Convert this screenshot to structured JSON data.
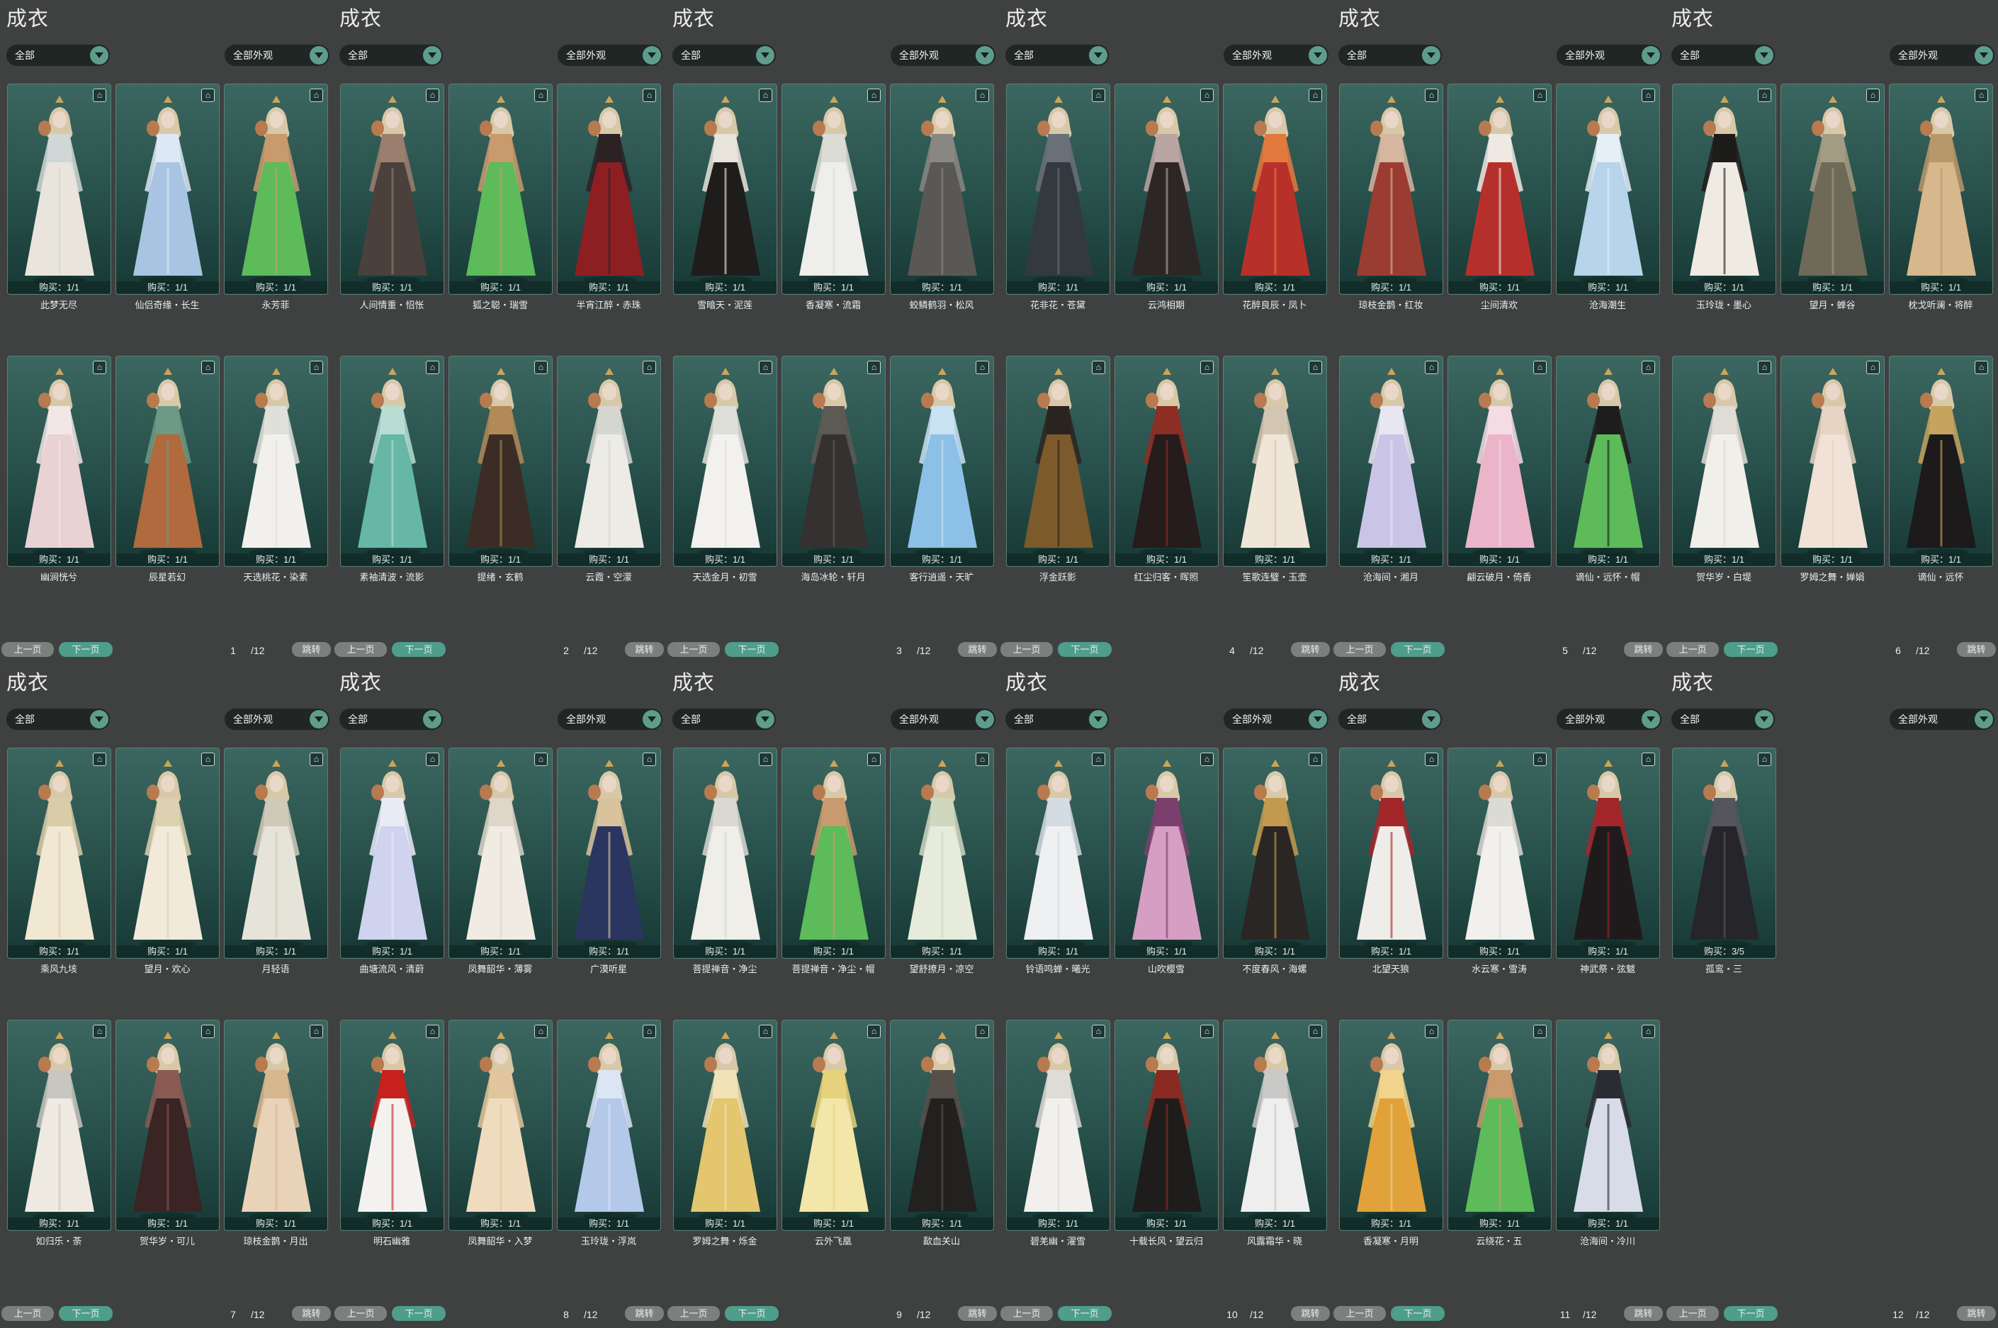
{
  "labels": {
    "category_title": "成衣",
    "filter_all": "全部",
    "filter_appearance": "全部外观",
    "prev_page": "上一页",
    "next_page": "下一页",
    "jump": "跳转",
    "lock_icon": "lock-icon"
  },
  "panels": [
    {
      "page": "1",
      "total": "/12",
      "items": [
        {
          "name": "此梦无尽",
          "buy": "购买：1/1",
          "colors": [
            "#e9e5dc",
            "#cfd8d6"
          ]
        },
        {
          "name": "仙侣奇缘・长生",
          "buy": "购买：1/1",
          "colors": [
            "#a9c4e3",
            "#dce8f3"
          ]
        },
        {
          "name": "永芳菲",
          "buy": "购买：1/1",
          "colors": [
            "#5dbb5a",
            "#c89a6e"
          ]
        },
        {
          "name": "幽涧恍兮",
          "buy": "购买：1/1",
          "colors": [
            "#e8d2d4",
            "#f1e6e6"
          ]
        },
        {
          "name": "辰星若幻",
          "buy": "购买：1/1",
          "colors": [
            "#b06a3d",
            "#6c9a84"
          ]
        },
        {
          "name": "天选桃花・染素",
          "buy": "购买：1/1",
          "colors": [
            "#f1f0ec",
            "#e0e0da"
          ]
        }
      ]
    },
    {
      "page": "2",
      "total": "/12",
      "items": [
        {
          "name": "人间情重・怊怅",
          "buy": "购买：1/1",
          "colors": [
            "#4a403c",
            "#9b7f6e"
          ]
        },
        {
          "name": "狐之聪・瑞雪",
          "buy": "购买：1/1",
          "colors": [
            "#5dbb5a",
            "#c89a6e"
          ]
        },
        {
          "name": "半宵江醉・赤珠",
          "buy": "购买：1/1",
          "colors": [
            "#8d1f22",
            "#2b2224"
          ]
        },
        {
          "name": "素袖清波・流影",
          "buy": "购买：1/1",
          "colors": [
            "#67b7a6",
            "#b8ddd3"
          ]
        },
        {
          "name": "提绪・玄鹤",
          "buy": "购买：1/1",
          "colors": [
            "#3b2d26",
            "#b28a57"
          ]
        },
        {
          "name": "云霞・空濛",
          "buy": "购买：1/1",
          "colors": [
            "#ecebe6",
            "#d6d6d1"
          ]
        }
      ]
    },
    {
      "page": "3",
      "total": "/12",
      "items": [
        {
          "name": "雪暗天・泥莲",
          "buy": "购买：1/1",
          "colors": [
            "#1f1d1c",
            "#e9e4db"
          ]
        },
        {
          "name": "香凝寒・流霜",
          "buy": "购买：1/1",
          "colors": [
            "#eeeeea",
            "#dcdcd6"
          ]
        },
        {
          "name": "蛟鳞鹤羽・松风",
          "buy": "购买：1/1",
          "colors": [
            "#5a5854",
            "#8a8782"
          ]
        },
        {
          "name": "天选金月・初雪",
          "buy": "购买：1/1",
          "colors": [
            "#f2f1ed",
            "#dfdfd9"
          ]
        },
        {
          "name": "海岛冰轮・轩月",
          "buy": "购买：1/1",
          "colors": [
            "#343130",
            "#5d5955"
          ]
        },
        {
          "name": "客行逍遥・天旷",
          "buy": "购买：1/1",
          "colors": [
            "#8cc0e6",
            "#c9e2f2"
          ]
        }
      ]
    },
    {
      "page": "4",
      "total": "/12",
      "items": [
        {
          "name": "花非花・苍黛",
          "buy": "购买：1/1",
          "colors": [
            "#34383f",
            "#6a707a"
          ]
        },
        {
          "name": "云鸿相期",
          "buy": "购买：1/1",
          "colors": [
            "#2c2725",
            "#b9a6a2"
          ]
        },
        {
          "name": "花醉良辰・凤卜",
          "buy": "购买：1/1",
          "colors": [
            "#b8302a",
            "#e27a3e"
          ]
        },
        {
          "name": "浮金跃影",
          "buy": "购买：1/1",
          "colors": [
            "#7c5a2b",
            "#2a2420"
          ]
        },
        {
          "name": "红尘归客・晖照",
          "buy": "购买：1/1",
          "colors": [
            "#251c1b",
            "#8c2e24"
          ]
        },
        {
          "name": "笙歌连璧・玉壶",
          "buy": "购买：1/1",
          "colors": [
            "#efe6d8",
            "#d3c6b1"
          ]
        }
      ]
    },
    {
      "page": "5",
      "total": "/12",
      "items": [
        {
          "name": "琼枝金鹊・红妆",
          "buy": "购买：1/1",
          "colors": [
            "#9b3c32",
            "#d5b6a0"
          ]
        },
        {
          "name": "尘间清欢",
          "buy": "购买：1/1",
          "colors": [
            "#b5302c",
            "#efe9e3"
          ]
        },
        {
          "name": "沧海潮生",
          "buy": "购买：1/1",
          "colors": [
            "#b7d4ea",
            "#e4eff6"
          ]
        },
        {
          "name": "沧海间・湘月",
          "buy": "购买：1/1",
          "colors": [
            "#cac4e6",
            "#e9e6f3"
          ]
        },
        {
          "name": "翩云破月・倚香",
          "buy": "购买：1/1",
          "colors": [
            "#eab5c8",
            "#f3dce4"
          ]
        },
        {
          "name": "谪仙・远怀・帽",
          "buy": "购买：1/1",
          "colors": [
            "#5dbb5a",
            "#1d1d1d"
          ]
        }
      ]
    },
    {
      "page": "6",
      "total": "/12",
      "items": [
        {
          "name": "玉玲珑・墨心",
          "buy": "购买：1/1",
          "colors": [
            "#efeae2",
            "#1e1c1b"
          ]
        },
        {
          "name": "望月・蝉谷",
          "buy": "购买：1/1",
          "colors": [
            "#6f6a58",
            "#a39c83"
          ]
        },
        {
          "name": "枕戈听澜・将醉",
          "buy": "购买：1/1",
          "colors": [
            "#d7b88c",
            "#b8976a"
          ]
        },
        {
          "name": "贺华岁・白堤",
          "buy": "购买：1/1",
          "colors": [
            "#f1efe9",
            "#dedcd4"
          ]
        },
        {
          "name": "罗姆之舞・婵娟",
          "buy": "购买：1/1",
          "colors": [
            "#f0e2d6",
            "#e6d3c2"
          ]
        },
        {
          "name": "谪仙・远怀",
          "buy": "购买：1/1",
          "colors": [
            "#1c1a1a",
            "#c6a45e"
          ]
        }
      ]
    },
    {
      "page": "7",
      "total": "/12",
      "items": [
        {
          "name": "乘风九垓",
          "buy": "购买：1/1",
          "colors": [
            "#f0e8d2",
            "#d9cca9"
          ]
        },
        {
          "name": "望月・欢心",
          "buy": "购买：1/1",
          "colors": [
            "#f1ead9",
            "#ddd1b1"
          ]
        },
        {
          "name": "月轻语",
          "buy": "购买：1/1",
          "colors": [
            "#e6e3d9",
            "#cfcab8"
          ]
        },
        {
          "name": "如归乐・荼",
          "buy": "购买：1/1",
          "colors": [
            "#eeeae2",
            "#c7c6c0"
          ]
        },
        {
          "name": "贺华岁・可儿",
          "buy": "购买：1/1",
          "colors": [
            "#3a2424",
            "#8a5b52"
          ]
        },
        {
          "name": "琼枝金鹊・月出",
          "buy": "购买：1/1",
          "colors": [
            "#e9d3b8",
            "#d8b78f"
          ]
        }
      ]
    },
    {
      "page": "8",
      "total": "/12",
      "items": [
        {
          "name": "曲塘流风・清蔚",
          "buy": "购买：1/1",
          "colors": [
            "#cfd3ee",
            "#e9ebf6"
          ]
        },
        {
          "name": "凤舞韶华・薄雾",
          "buy": "购买：1/1",
          "colors": [
            "#f1ece3",
            "#ddd6c9"
          ]
        },
        {
          "name": "广漠听星",
          "buy": "购买：1/1",
          "colors": [
            "#2a3560",
            "#d9c39c"
          ]
        },
        {
          "name": "明石幽雅",
          "buy": "购买：1/1",
          "colors": [
            "#f4f2ef",
            "#c7211f"
          ]
        },
        {
          "name": "凤舞韶华・入梦",
          "buy": "购买：1/1",
          "colors": [
            "#efdcbf",
            "#e0c59d"
          ]
        },
        {
          "name": "玉玲珑・浮岚",
          "buy": "购买：1/1",
          "colors": [
            "#b4c8ea",
            "#dbe5f5"
          ]
        }
      ]
    },
    {
      "page": "9",
      "total": "/12",
      "items": [
        {
          "name": "菩提禅音・净尘",
          "buy": "购买：1/1",
          "colors": [
            "#efeee9",
            "#d9d9d2"
          ]
        },
        {
          "name": "菩提禅音・净尘・帽",
          "buy": "购买：1/1",
          "colors": [
            "#5dbb5a",
            "#c89a6e"
          ]
        },
        {
          "name": "望舒撩月・凉空",
          "buy": "购买：1/1",
          "colors": [
            "#e7ebdc",
            "#cfd7bf"
          ]
        },
        {
          "name": "罗姆之舞・烁金",
          "buy": "购买：1/1",
          "colors": [
            "#e3c66d",
            "#f0e3b6"
          ]
        },
        {
          "name": "云外飞凰",
          "buy": "购买：1/1",
          "colors": [
            "#f2e6a9",
            "#e5d27a"
          ]
        },
        {
          "name": "歃血关山",
          "buy": "购买：1/1",
          "colors": [
            "#232120",
            "#56504a"
          ]
        }
      ]
    },
    {
      "page": "10",
      "total": "/12",
      "items": [
        {
          "name": "铃语鸣蝉・曦光",
          "buy": "购买：1/1",
          "colors": [
            "#eef0f2",
            "#d5dbe2"
          ]
        },
        {
          "name": "山吹樱雪",
          "buy": "购买：1/1",
          "colors": [
            "#d79ec4",
            "#7b3f6e"
          ]
        },
        {
          "name": "不度春风・海螺",
          "buy": "购买：1/1",
          "colors": [
            "#2a2624",
            "#c39a4f"
          ]
        },
        {
          "name": "碧羌幽・濯雪",
          "buy": "购买：1/1",
          "colors": [
            "#f1f0ec",
            "#dedcd6"
          ]
        },
        {
          "name": "十载长风・望云归",
          "buy": "购买：1/1",
          "colors": [
            "#1f1c1c",
            "#8a2a22"
          ]
        },
        {
          "name": "风露霜华・晓",
          "buy": "购买：1/1",
          "colors": [
            "#eeeeee",
            "#c9c9c7"
          ]
        }
      ]
    },
    {
      "page": "11",
      "total": "/12",
      "items": [
        {
          "name": "北望天狼",
          "buy": "购买：1/1",
          "colors": [
            "#efedea",
            "#a3262a"
          ]
        },
        {
          "name": "水云寒・雪涛",
          "buy": "购买：1/1",
          "colors": [
            "#f1f0ec",
            "#dcdad4"
          ]
        },
        {
          "name": "神武祭・弦魃",
          "buy": "购买：1/1",
          "colors": [
            "#1f1b1c",
            "#a3262a"
          ]
        },
        {
          "name": "香凝寒・月明",
          "buy": "购买：1/1",
          "colors": [
            "#e1a23a",
            "#f1d38b"
          ]
        },
        {
          "name": "云绕花・五",
          "buy": "购买：1/1",
          "colors": [
            "#5dbb5a",
            "#c89a6e"
          ]
        },
        {
          "name": "沧海间・冷川",
          "buy": "购买：1/1",
          "colors": [
            "#d8dbe8",
            "#2b2b33"
          ]
        }
      ]
    },
    {
      "page": "12",
      "total": "/12",
      "items": [
        {
          "name": "孤鸾・三",
          "buy": "购买：3/5",
          "colors": [
            "#26262a",
            "#55555c"
          ]
        }
      ]
    }
  ]
}
